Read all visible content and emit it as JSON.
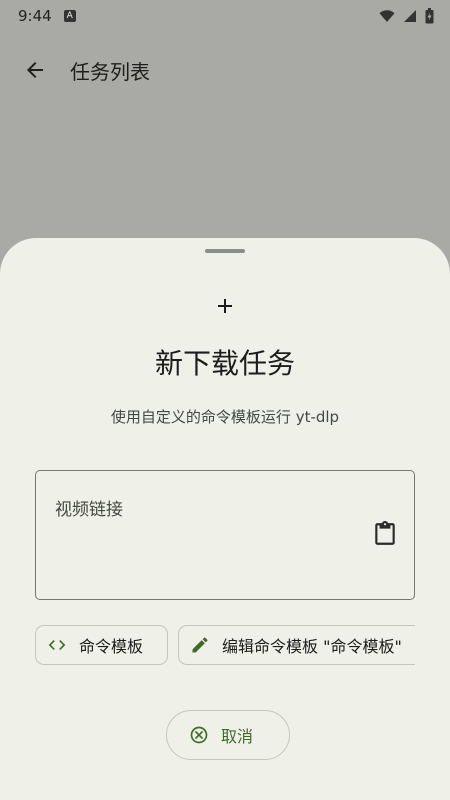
{
  "status_bar": {
    "time": "9:44",
    "notification_badge": "A",
    "icons": [
      "wifi-icon",
      "signal-icon",
      "battery-icon"
    ]
  },
  "app_bar": {
    "title": "任务列表",
    "back_icon": "arrow-back-icon"
  },
  "sheet": {
    "title": "新下载任务",
    "subtitle": "使用自定义的命令模板运行 yt-dlp",
    "url_input": {
      "placeholder": "视频链接",
      "value": ""
    },
    "chips": {
      "template_label": "命令模板",
      "edit_label": "编辑命令模板 \"命令模板\""
    },
    "cancel_label": "取消"
  },
  "colors": {
    "scrim": "#a9a9a5",
    "sheet_background": "#eff1e8",
    "accent": "#3d6b2a",
    "outline": "#74786f"
  }
}
